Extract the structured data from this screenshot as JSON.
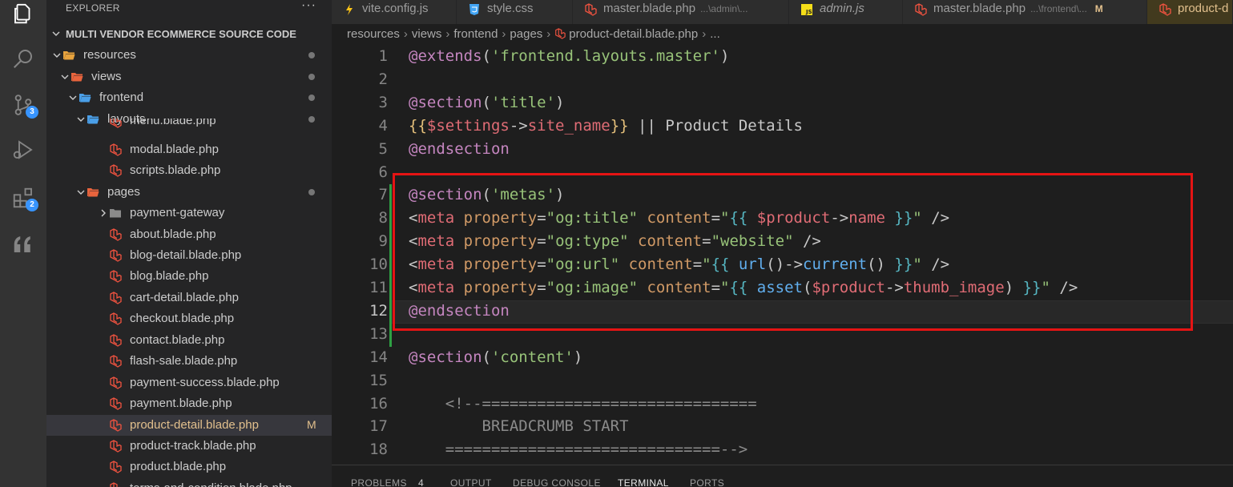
{
  "activity_bar": {
    "items": [
      {
        "name": "explorer-icon",
        "badge": ""
      },
      {
        "name": "search-icon",
        "badge": ""
      },
      {
        "name": "source-control-icon",
        "badge": "3"
      },
      {
        "name": "run-debug-icon",
        "badge": ""
      },
      {
        "name": "extensions-icon",
        "badge": "2"
      },
      {
        "name": "quote-icon",
        "badge": ""
      }
    ]
  },
  "explorer": {
    "title": "EXPLORER",
    "more": "···",
    "project": "MULTI VENDOR ECOMMERCE SOURCE CODE",
    "rows": [
      {
        "label": "resources",
        "type": "folder-open",
        "color": "#e8a33d",
        "dot": true
      },
      {
        "label": "views",
        "type": "folder-open-views",
        "color": "#e8643d",
        "dot": true
      },
      {
        "label": "frontend",
        "type": "folder-open-blue",
        "color": "#4a9fe8",
        "dot": true
      },
      {
        "label": "layouts",
        "type": "folder-open-blue",
        "color": "#4a9fe8",
        "dot": true
      },
      {
        "label": "menu.blade.php",
        "type": "laravel"
      },
      {
        "label": "modal.blade.php",
        "type": "laravel"
      },
      {
        "label": "scripts.blade.php",
        "type": "laravel"
      },
      {
        "label": "pages",
        "type": "folder-open-red",
        "color": "#e8643d",
        "dot": true
      },
      {
        "label": "payment-gateway",
        "type": "folder-closed"
      },
      {
        "label": "about.blade.php",
        "type": "laravel"
      },
      {
        "label": "blog-detail.blade.php",
        "type": "laravel"
      },
      {
        "label": "blog.blade.php",
        "type": "laravel"
      },
      {
        "label": "cart-detail.blade.php",
        "type": "laravel"
      },
      {
        "label": "checkout.blade.php",
        "type": "laravel"
      },
      {
        "label": "contact.blade.php",
        "type": "laravel"
      },
      {
        "label": "flash-sale.blade.php",
        "type": "laravel"
      },
      {
        "label": "payment-success.blade.php",
        "type": "laravel"
      },
      {
        "label": "payment.blade.php",
        "type": "laravel"
      },
      {
        "label": "product-detail.blade.php",
        "type": "laravel",
        "selected": true,
        "modified": "M"
      },
      {
        "label": "product-track.blade.php",
        "type": "laravel"
      },
      {
        "label": "product.blade.php",
        "type": "laravel"
      },
      {
        "label": "terms-and-condition.blade.php",
        "type": "laravel"
      }
    ]
  },
  "tabs": [
    {
      "icon": "vite-icon",
      "label": "vite.config.js",
      "path": "",
      "mod": ""
    },
    {
      "icon": "css-icon",
      "label": "style.css",
      "path": "",
      "mod": ""
    },
    {
      "icon": "laravel-icon",
      "label": "master.blade.php",
      "path": "...\\admin\\...",
      "mod": ""
    },
    {
      "icon": "js-icon",
      "label": "admin.js",
      "path": "",
      "mod": ""
    },
    {
      "icon": "laravel-icon",
      "label": "master.blade.php",
      "path": "...\\frontend\\...",
      "mod": "M"
    },
    {
      "icon": "laravel-icon",
      "label": "product-d",
      "path": "",
      "mod": ""
    }
  ],
  "breadcrumb": [
    "resources",
    "views",
    "frontend",
    "pages",
    "product-detail.blade.php",
    "..."
  ],
  "editor": {
    "current_line": 12,
    "lines": [
      {
        "n": "1",
        "tokens": [
          [
            "k-dir",
            "@extends"
          ],
          [
            "k-punc",
            "("
          ],
          [
            "k-str",
            "'frontend.layouts.master'"
          ],
          [
            "k-punc",
            ")"
          ]
        ]
      },
      {
        "n": "2",
        "tokens": []
      },
      {
        "n": "3",
        "tokens": [
          [
            "k-dir",
            "@section"
          ],
          [
            "k-punc",
            "("
          ],
          [
            "k-str",
            "'title'"
          ],
          [
            "k-punc",
            ")"
          ]
        ]
      },
      {
        "n": "4",
        "tokens": [
          [
            "k-brace",
            "{{"
          ],
          [
            "k-var",
            "$settings"
          ],
          [
            "k-punc",
            "->"
          ],
          [
            "k-var",
            "site_name"
          ],
          [
            "k-brace",
            "}}"
          ],
          [
            "k-text",
            " || Product Details"
          ]
        ]
      },
      {
        "n": "5",
        "tokens": [
          [
            "k-dir",
            "@endsection"
          ]
        ]
      },
      {
        "n": "6",
        "tokens": []
      },
      {
        "n": "7",
        "tokens": [
          [
            "k-dir",
            "@section"
          ],
          [
            "k-punc",
            "("
          ],
          [
            "k-str",
            "'metas'"
          ],
          [
            "k-punc",
            ")"
          ]
        ]
      },
      {
        "n": "8",
        "tokens": [
          [
            "k-punc",
            "<"
          ],
          [
            "k-tag",
            "meta"
          ],
          [
            "k-punc",
            " "
          ],
          [
            "k-attr",
            "property"
          ],
          [
            "k-punc",
            "="
          ],
          [
            "k-str",
            "\"og:title\""
          ],
          [
            "k-punc",
            " "
          ],
          [
            "k-attr",
            "content"
          ],
          [
            "k-punc",
            "="
          ],
          [
            "k-str",
            "\""
          ],
          [
            "k-brace2",
            "{{ "
          ],
          [
            "k-var",
            "$product"
          ],
          [
            "k-punc",
            "->"
          ],
          [
            "k-var",
            "name"
          ],
          [
            "k-brace2",
            " }}"
          ],
          [
            "k-str",
            "\""
          ],
          [
            "k-punc",
            " />"
          ]
        ]
      },
      {
        "n": "9",
        "tokens": [
          [
            "k-punc",
            "<"
          ],
          [
            "k-tag",
            "meta"
          ],
          [
            "k-punc",
            " "
          ],
          [
            "k-attr",
            "property"
          ],
          [
            "k-punc",
            "="
          ],
          [
            "k-str",
            "\"og:type\""
          ],
          [
            "k-punc",
            " "
          ],
          [
            "k-attr",
            "content"
          ],
          [
            "k-punc",
            "="
          ],
          [
            "k-str",
            "\"website\""
          ],
          [
            "k-punc",
            " />"
          ]
        ]
      },
      {
        "n": "10",
        "tokens": [
          [
            "k-punc",
            "<"
          ],
          [
            "k-tag",
            "meta"
          ],
          [
            "k-punc",
            " "
          ],
          [
            "k-attr",
            "property"
          ],
          [
            "k-punc",
            "="
          ],
          [
            "k-str",
            "\"og:url\""
          ],
          [
            "k-punc",
            " "
          ],
          [
            "k-attr",
            "content"
          ],
          [
            "k-punc",
            "="
          ],
          [
            "k-str",
            "\""
          ],
          [
            "k-brace2",
            "{{ "
          ],
          [
            "k-func",
            "url"
          ],
          [
            "k-punc",
            "()->"
          ],
          [
            "k-func",
            "current"
          ],
          [
            "k-punc",
            "()"
          ],
          [
            "k-brace2",
            " }}"
          ],
          [
            "k-str",
            "\""
          ],
          [
            "k-punc",
            " />"
          ]
        ]
      },
      {
        "n": "11",
        "tokens": [
          [
            "k-punc",
            "<"
          ],
          [
            "k-tag",
            "meta"
          ],
          [
            "k-punc",
            " "
          ],
          [
            "k-attr",
            "property"
          ],
          [
            "k-punc",
            "="
          ],
          [
            "k-str",
            "\"og:image\""
          ],
          [
            "k-punc",
            " "
          ],
          [
            "k-attr",
            "content"
          ],
          [
            "k-punc",
            "="
          ],
          [
            "k-str",
            "\""
          ],
          [
            "k-brace2",
            "{{ "
          ],
          [
            "k-func",
            "asset"
          ],
          [
            "k-punc",
            "("
          ],
          [
            "k-var",
            "$product"
          ],
          [
            "k-punc",
            "->"
          ],
          [
            "k-var",
            "thumb_image"
          ],
          [
            "k-punc",
            ")"
          ],
          [
            "k-brace2",
            " }}"
          ],
          [
            "k-str",
            "\""
          ],
          [
            "k-punc",
            " />"
          ]
        ]
      },
      {
        "n": "12",
        "tokens": [
          [
            "k-dir",
            "@endsection"
          ]
        ]
      },
      {
        "n": "13",
        "tokens": []
      },
      {
        "n": "14",
        "tokens": [
          [
            "k-dir",
            "@section"
          ],
          [
            "k-punc",
            "("
          ],
          [
            "k-str",
            "'content'"
          ],
          [
            "k-punc",
            ")"
          ]
        ]
      },
      {
        "n": "15",
        "tokens": []
      },
      {
        "n": "16",
        "tokens": [
          [
            "k-cmt",
            "    <!--=============================="
          ]
        ]
      },
      {
        "n": "17",
        "tokens": [
          [
            "k-cmt",
            "        BREADCRUMB START"
          ]
        ]
      },
      {
        "n": "18",
        "tokens": [
          [
            "k-cmt",
            "    ==============================-->"
          ]
        ]
      }
    ]
  },
  "panel": {
    "tabs": [
      {
        "label": "PROBLEMS",
        "badge": "4"
      },
      {
        "label": "OUTPUT",
        "badge": ""
      },
      {
        "label": "DEBUG CONSOLE",
        "badge": ""
      },
      {
        "label": "TERMINAL",
        "badge": "",
        "active": true
      },
      {
        "label": "PORTS",
        "badge": ""
      }
    ]
  },
  "colors": {
    "highlight_box": "#e51414",
    "modified": "#e2c08d",
    "git_added": "#2ea043"
  }
}
